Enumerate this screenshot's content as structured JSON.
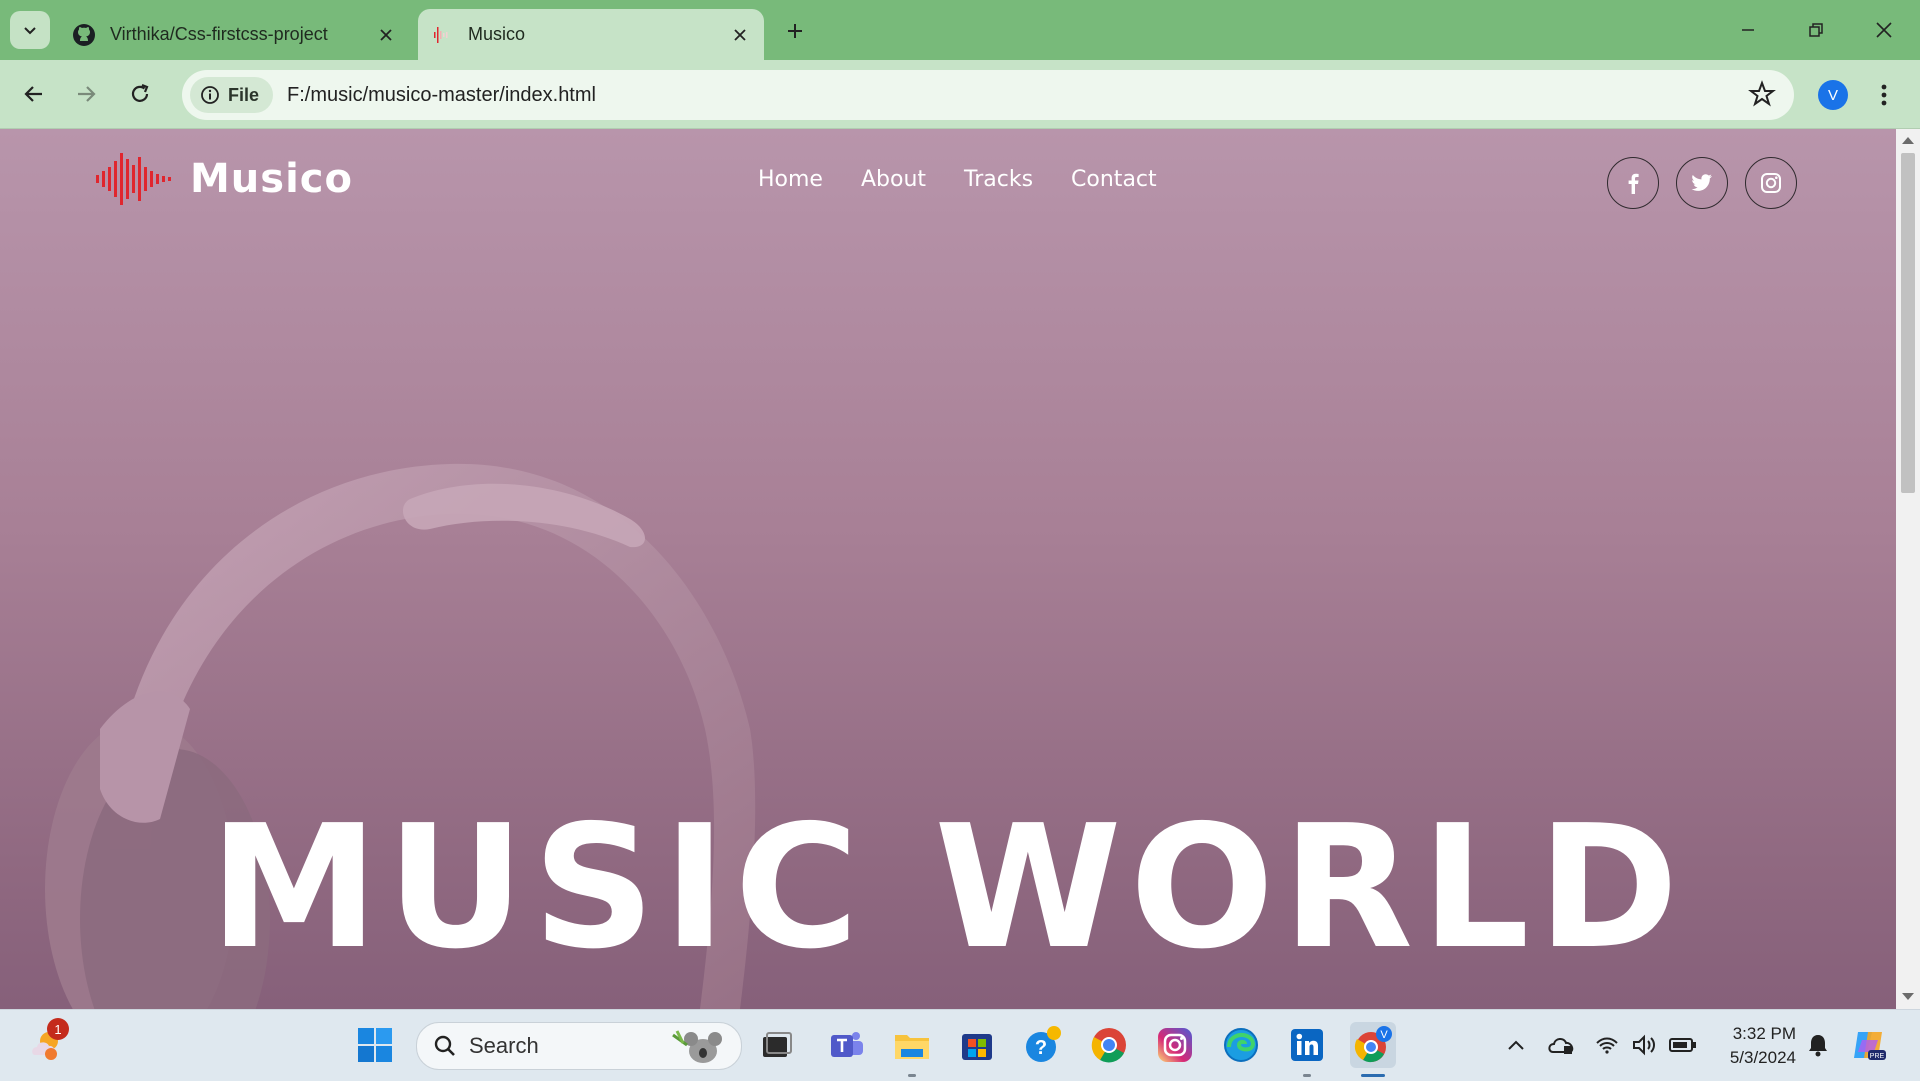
{
  "browser": {
    "tabs": [
      {
        "title": "Virthika/Css-firstcss-project",
        "active": false
      },
      {
        "title": "Musico",
        "active": true
      }
    ],
    "address": {
      "chip": "File",
      "url": "F:/music/musico-master/index.html"
    },
    "profile_initial": "V"
  },
  "site": {
    "logo_text": "Musico",
    "nav": [
      "Home",
      "About",
      "Tracks",
      "Contact"
    ],
    "social": [
      "facebook-icon",
      "twitter-icon",
      "instagram-icon"
    ],
    "hero_title": "MUSIC WORLD"
  },
  "taskbar": {
    "search_placeholder": "Search",
    "notification_badge": "1",
    "time": "3:32 PM",
    "date": "5/3/2024",
    "apps": [
      "start-icon",
      "task-view-icon",
      "teams-icon",
      "file-explorer-icon",
      "store-icon",
      "help-icon",
      "chrome-icon",
      "instagram-app-icon",
      "edge-icon",
      "linkedin-icon",
      "chrome-profile-icon"
    ]
  },
  "colors": {
    "tabstrip": "#78ba7a",
    "toolbar": "#c6e3c7",
    "hero_top": "#b895ab",
    "hero_bottom": "#86607a",
    "logo_accent": "#e0262e"
  }
}
